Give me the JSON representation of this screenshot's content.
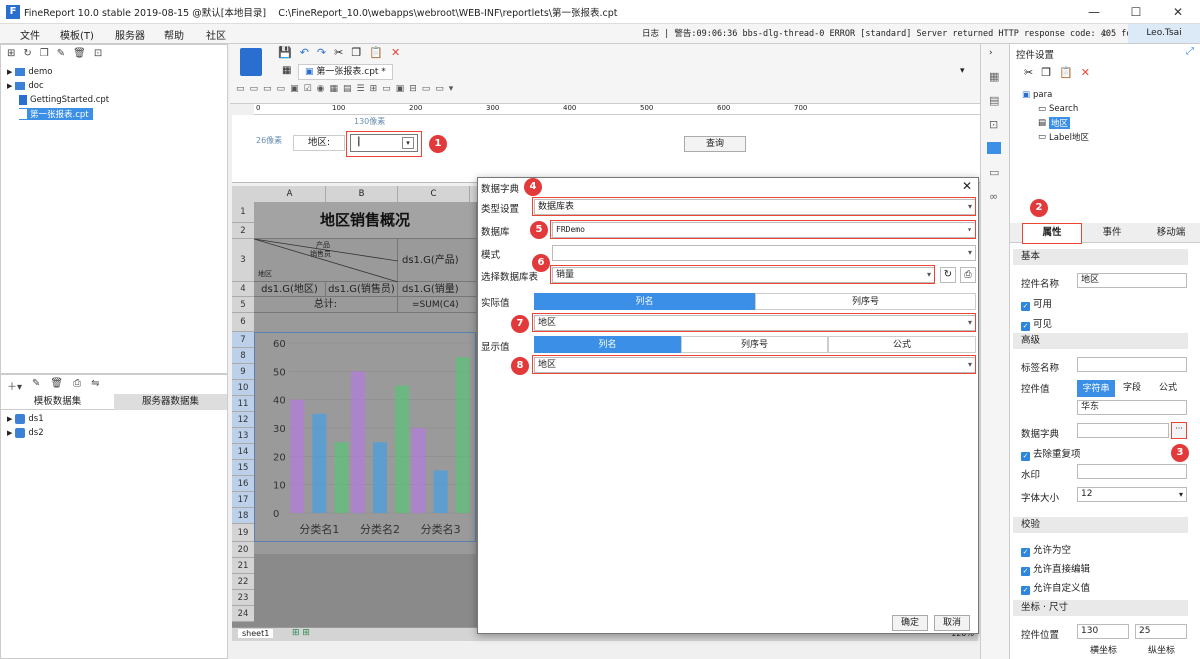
{
  "window": {
    "title": "FineReport 10.0 stable 2019-08-15 @默认[本地目录]    C:\\FineReport_10.0\\webapps\\webroot\\WEB-INF\\reportlets\\第一张报表.cpt",
    "user": "Leo.Tsai"
  },
  "menu": [
    "文件",
    "模板(T)",
    "服务器",
    "帮助",
    "社区"
  ],
  "log_text": "日志 | 警告:09:06:36 bbs-dlg-thread-0 ERROR [standard] Server returned HTTP response code: 405 fo",
  "file_tree": [
    "demo",
    "doc",
    "GettingStarted.cpt",
    "第一张报表.cpt"
  ],
  "dataset_tabs": [
    "模板数据集",
    "服务器数据集"
  ],
  "datasets": [
    "ds1",
    "ds2"
  ],
  "doc_tab": "第一张报表.cpt *",
  "ruler_ticks": [
    "0",
    "100",
    "200",
    "300",
    "400",
    "500",
    "600",
    "700"
  ],
  "param_area": {
    "width_hint": "130像素",
    "height_hint": "26像素",
    "label": "地区:",
    "query_button": "查询"
  },
  "sheet": {
    "columns": [
      "A",
      "B",
      "C"
    ],
    "rows": [
      "1",
      "2",
      "3",
      "4",
      "5",
      "6",
      "7",
      "8",
      "9",
      "10",
      "11",
      "12",
      "13",
      "14",
      "15",
      "16",
      "17",
      "18",
      "19",
      "20",
      "21",
      "22",
      "23",
      "24"
    ],
    "title": "地区销售概况",
    "header_product": "产品",
    "header_seller": "销售员",
    "header_region": "地区",
    "cell_b3": "ds1.G(产品)",
    "cell_a4": "ds1.G(地区)",
    "cell_b4": "ds1.G(销售员)",
    "cell_c4": "ds1.G(销量)",
    "total_label": "总计:",
    "total_formula": "=SUM(C4)",
    "sheet_tab": "sheet1",
    "zoom": "120%"
  },
  "chart_data": {
    "type": "bar",
    "categories": [
      "分类名1",
      "分类名2",
      "分类名3"
    ],
    "series": [
      {
        "values": [
          40,
          50,
          30
        ],
        "color": "#b07cd8"
      },
      {
        "values": [
          35,
          25,
          15
        ],
        "color": "#4a9fe0"
      },
      {
        "values": [
          25,
          45,
          55
        ],
        "color": "#5cc07a"
      }
    ],
    "y_ticks": [
      "0",
      "10",
      "20",
      "30",
      "40",
      "50",
      "60"
    ],
    "ylim": [
      0,
      60
    ]
  },
  "dialog": {
    "title": "数据字典",
    "type_label": "类型设置",
    "type_value": "数据库表",
    "db_label": "数据库",
    "db_value": "FRDemo",
    "mode_label": "模式",
    "table_label": "选择数据库表",
    "table_value": "销量",
    "actual_label": "实际值",
    "actual_tabs": [
      "列名",
      "列序号"
    ],
    "actual_value": "地区",
    "display_label": "显示值",
    "display_tabs": [
      "列名",
      "列序号",
      "公式"
    ],
    "display_value": "地区",
    "ok": "确定",
    "cancel": "取消"
  },
  "right_panel": {
    "title": "控件设置",
    "widget_tree": [
      "para",
      "Search",
      "地区",
      "Label地区"
    ],
    "tabs": [
      "属性",
      "事件",
      "移动端"
    ],
    "sec_basic": "基本",
    "name_label": "控件名称",
    "name_value": "地区",
    "enabled": "可用",
    "visible": "可见",
    "sec_advanced": "高级",
    "tag_label": "标签名称",
    "value_label": "控件值",
    "value_tabs": [
      "字符串",
      "字段",
      "公式"
    ],
    "value_value": "华东",
    "dict_label": "数据字典",
    "dict_btn": "···",
    "dedupe": "去除重复项",
    "watermark": "水印",
    "fontsize_label": "字体大小",
    "fontsize_value": "12",
    "sec_validate": "校验",
    "allow_empty": "允许为空",
    "allow_edit": "允许直接编辑",
    "allow_custom": "允许自定义值",
    "sec_pos": "坐标 · 尺寸",
    "pos_label": "控件位置",
    "pos_x": "130",
    "pos_y": "25",
    "x_axis": "横坐标",
    "y_axis": "纵坐标"
  },
  "badges": [
    "1",
    "2",
    "3",
    "4",
    "5",
    "6",
    "7",
    "8"
  ]
}
